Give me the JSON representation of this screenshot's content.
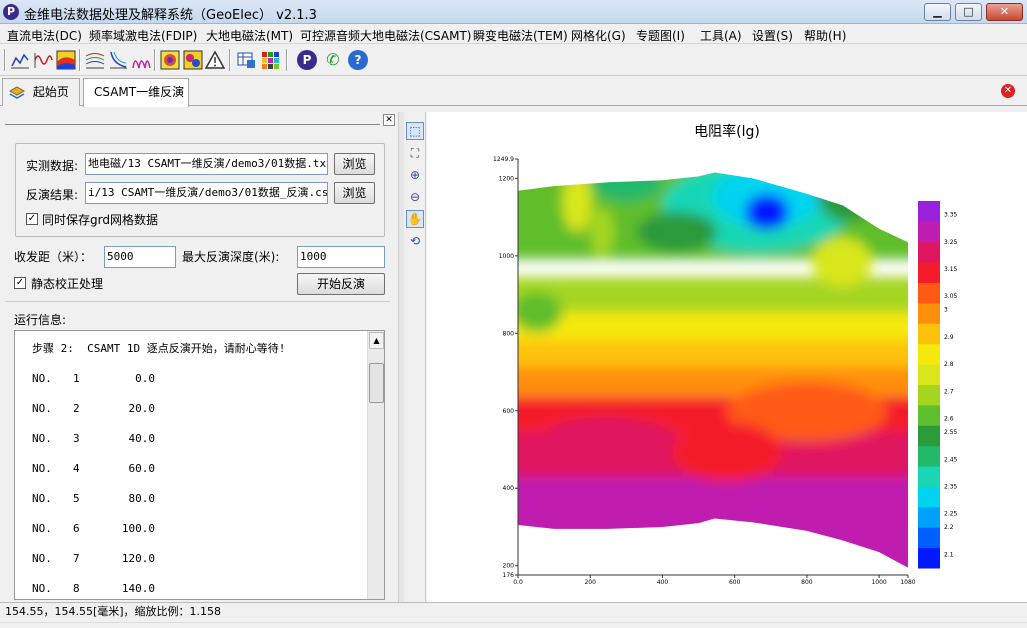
{
  "window": {
    "title": "金维电法数据处理及解释系统（GeoElec） v2.1.3",
    "icon_letter": "P",
    "min_glyph": "▁",
    "max_glyph": "□",
    "close_glyph": "✕"
  },
  "menu": [
    "直流电法(DC)",
    "频率域激电法(FDIP)",
    "大地电磁法(MT)",
    "可控源音频大地电磁法(CSAMT)",
    "瞬变电磁法(TEM)",
    "网格化(G)",
    "专题图(I)",
    "工具(A)",
    "设置(S)",
    "帮助(H)"
  ],
  "toolbar": {
    "icons": [
      "profile-curve-icon",
      "wave-curve-icon",
      "color-map-icon",
      "multi-curve-icon",
      "sounding-curve-icon",
      "pseudo-section-icon",
      "contour-map-icon",
      "grid-color-icon",
      "warning-triangle-icon",
      "export-table-icon",
      "color-grid-icon",
      "app-logo-icon",
      "phone-contact-icon",
      "help-icon"
    ],
    "logo_letter": "P",
    "help_glyph": "?",
    "phone_glyph": "✆"
  },
  "tabs": [
    {
      "label": "起始页",
      "active": false
    },
    {
      "label": "CSAMT一维反演",
      "active": true
    }
  ],
  "close_glyph": "✕",
  "form": {
    "data_label": "实测数据:",
    "data_value": "地电磁/13 CSAMT一维反演/demo3/01数据.txt",
    "browse1": "浏览",
    "result_label": "反演结果:",
    "result_value": "i/13 CSAMT一维反演/demo3/01数据_反演.csv",
    "browse2": "浏览",
    "grd_label": "同时保存grd网格数据",
    "grd_checked": true,
    "distance_label": "收发距（米）：",
    "distance_value": "5000",
    "depth_label": "最大反演深度(米):",
    "depth_value": "1000",
    "static_label": "静态校正处理",
    "static_checked": true,
    "start_button": "开始反演",
    "check_glyph": "✓"
  },
  "log": {
    "label": "运行信息:",
    "step_line": "步骤 2:  CSAMT 1D 逐点反演开始，请耐心等待!",
    "rows": [
      {
        "tag": "NO.",
        "n": "1",
        "v": "0.0"
      },
      {
        "tag": "NO.",
        "n": "2",
        "v": "20.0"
      },
      {
        "tag": "NO.",
        "n": "3",
        "v": "40.0"
      },
      {
        "tag": "NO.",
        "n": "4",
        "v": "60.0"
      },
      {
        "tag": "NO.",
        "n": "5",
        "v": "80.0"
      },
      {
        "tag": "NO.",
        "n": "6",
        "v": "100.0"
      },
      {
        "tag": "NO.",
        "n": "7",
        "v": "120.0"
      },
      {
        "tag": "NO.",
        "n": "8",
        "v": "140.0"
      }
    ],
    "scroll_up": "▲"
  },
  "vtools": {
    "icons": [
      "ruler-icon",
      "fit-extent-icon",
      "zoom-in-icon",
      "zoom-out-icon",
      "pan-hand-icon",
      "refresh-icon"
    ],
    "glyphs": [
      "⬚",
      "⛶",
      "⊕",
      "⊖",
      "✋",
      "⟲"
    ]
  },
  "chart_data": {
    "type": "heatmap",
    "title": "电阻率(lg)",
    "x_ticks": [
      "0.0",
      "200",
      "400",
      "600",
      "800",
      "1000",
      "1080"
    ],
    "x_tick_values": [
      0,
      200,
      400,
      600,
      800,
      1000,
      1080
    ],
    "xlim": [
      0,
      1080
    ],
    "y_ticks": [
      "1249.9",
      "1200",
      "1000",
      "800",
      "600",
      "400",
      "200",
      "176"
    ],
    "y_tick_values": [
      1249.9,
      1200,
      1000,
      800,
      600,
      400,
      200,
      176
    ],
    "ylim": [
      176,
      1249.9
    ],
    "top_surface": [
      [
        0,
        1168
      ],
      [
        100,
        1180
      ],
      [
        250,
        1190
      ],
      [
        400,
        1195
      ],
      [
        500,
        1205
      ],
      [
        545,
        1215
      ],
      [
        650,
        1200
      ],
      [
        800,
        1160
      ],
      [
        900,
        1130
      ],
      [
        1000,
        1070
      ],
      [
        1080,
        1035
      ]
    ],
    "bottom_surface": [
      [
        0,
        305
      ],
      [
        100,
        295
      ],
      [
        250,
        295
      ],
      [
        400,
        300
      ],
      [
        500,
        310
      ],
      [
        545,
        322
      ],
      [
        650,
        312
      ],
      [
        800,
        290
      ],
      [
        900,
        265
      ],
      [
        1000,
        235
      ],
      [
        1080,
        195
      ]
    ],
    "colorbar": {
      "tick_labels": [
        "3.35",
        "3.25",
        "3.15",
        "3.05",
        "3",
        "2.9",
        "2.8",
        "2.7",
        "2.6",
        "2.55",
        "2.45",
        "2.35",
        "2.25",
        "2.2",
        "2.1"
      ],
      "min": 2.05,
      "max": 3.4,
      "colors": [
        "#0019ff",
        "#0060ff",
        "#00a0ff",
        "#00d4f0",
        "#19d7b5",
        "#22b96a",
        "#2b9a3a",
        "#5fbe2c",
        "#a4d620",
        "#d8e61a",
        "#f5e80b",
        "#ffc20a",
        "#ff8f0a",
        "#ff5a14",
        "#f51c2a",
        "#e01660",
        "#c01db0",
        "#9b22dc"
      ]
    },
    "grid": false,
    "legend_position": "right"
  },
  "status": {
    "text": "154.55，154.55[毫米]，缩放比例：1.158"
  }
}
